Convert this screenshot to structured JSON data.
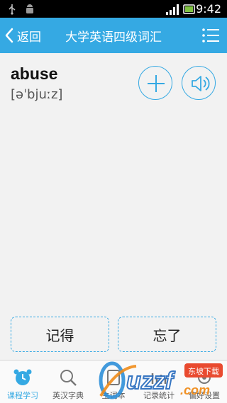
{
  "status_bar": {
    "time": "9:42",
    "icons": [
      "usb-icon",
      "android-debug-icon",
      "signal-icon",
      "battery-icon"
    ]
  },
  "header": {
    "back_label": "返回",
    "title": "大学英语四级词汇",
    "menu_icon": "list-menu-icon"
  },
  "word_card": {
    "word": "abuse",
    "phonetic": "[əˈbjuːz]",
    "add_icon": "plus-icon",
    "sound_icon": "speaker-icon"
  },
  "answers": {
    "remember_label": "记得",
    "forget_label": "忘了"
  },
  "tabs": [
    {
      "label": "课程学习",
      "icon": "alarm-clock-icon",
      "active": true
    },
    {
      "label": "英汉字典",
      "icon": "search-icon",
      "active": false
    },
    {
      "label": "生词本",
      "icon": "notebook-icon",
      "active": false
    },
    {
      "label": "记录统计",
      "icon": "chart-icon",
      "active": false
    },
    {
      "label": "偏好设置",
      "icon": "settings-icon",
      "active": false
    }
  ],
  "watermark": {
    "text": "uzzf.com",
    "badge": "东坡下载"
  },
  "colors": {
    "accent": "#35a9e3",
    "status_bar": "#000000",
    "background": "#f2f2f2"
  }
}
